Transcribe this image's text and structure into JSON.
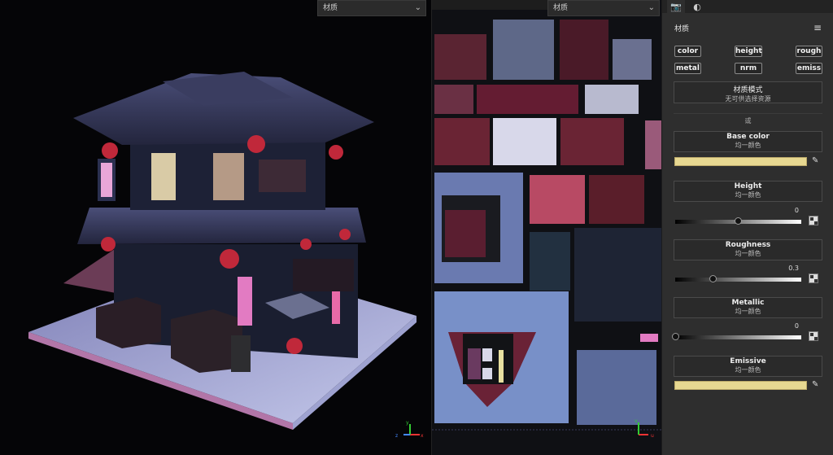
{
  "viewport3d": {
    "dropdown_label": "材质"
  },
  "viewportUV": {
    "dropdown_label": "材质"
  },
  "axes": {
    "x": "x",
    "y": "y",
    "z": "z",
    "u": "u",
    "v": "v"
  },
  "panel": {
    "title": "材质",
    "channels": [
      {
        "label": "color"
      },
      {
        "label": "height"
      },
      {
        "label": "rough"
      },
      {
        "label": "metal"
      },
      {
        "label": "nrm"
      },
      {
        "label": "emiss"
      }
    ],
    "material_mode": {
      "title": "材质模式",
      "subtitle": "无可供选择资源"
    },
    "or_label": "或",
    "base_color": {
      "title": "Base color",
      "subtitle": "均一颜色",
      "color": "#e7d891"
    },
    "height": {
      "title": "Height",
      "subtitle": "均一颜色",
      "value": "0",
      "fraction": 0.5
    },
    "roughness": {
      "title": "Roughness",
      "subtitle": "均一颜色",
      "value": "0.3",
      "fraction": 0.3
    },
    "metallic": {
      "title": "Metallic",
      "subtitle": "均一颜色",
      "value": "0",
      "fraction": 0.0
    },
    "emissive": {
      "title": "Emissive",
      "subtitle": "均一颜色",
      "color": "#e7d891"
    }
  }
}
